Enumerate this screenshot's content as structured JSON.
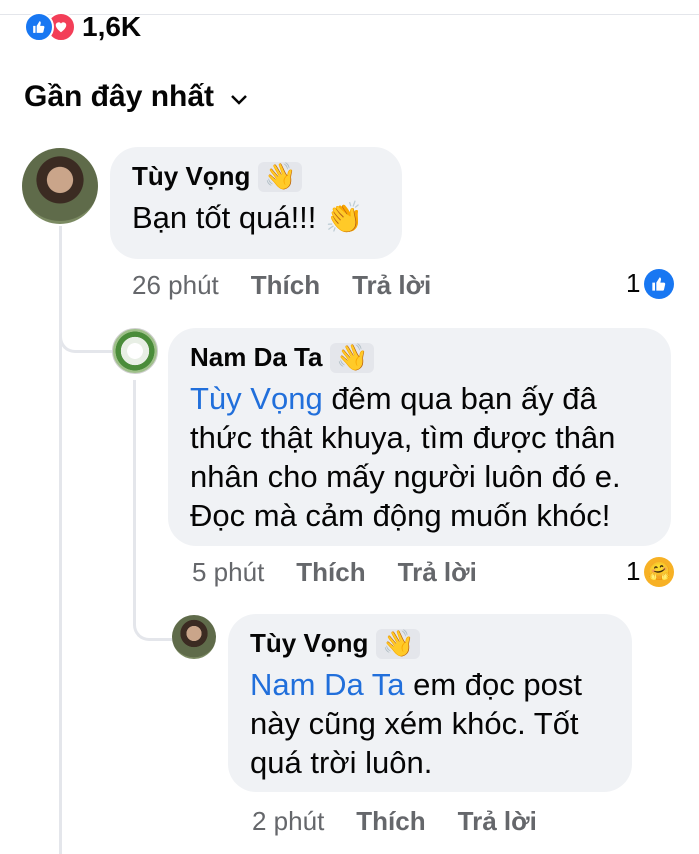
{
  "reactions": {
    "count": "1,6K",
    "icons": [
      "like-icon",
      "love-icon"
    ]
  },
  "sort": {
    "label": "Gần đây nhất"
  },
  "comments": [
    {
      "author": "Tùy Vọng",
      "text": "Bạn tốt quá!!!",
      "emoji": "👏",
      "time": "26 phút",
      "like": "Thích",
      "reply": "Trả lời",
      "reaction_count": "1",
      "reaction_icon": "like-icon"
    },
    {
      "author": "Nam Da Ta",
      "mention": "Tùy Vọng",
      "text": " đêm qua bạn ấy đâ thức thật khuya, tìm được thân nhân cho mấy người luôn đó e. Đọc mà cảm động muốn khóc!",
      "time": "5 phút",
      "like": "Thích",
      "reply": "Trả lời",
      "reaction_count": "1",
      "reaction_icon": "care-icon"
    },
    {
      "author": "Tùy Vọng",
      "mention": "Nam Da Ta",
      "text": " em đọc post này cũng xém khóc. Tốt quá trời luôn.",
      "time": "2 phút",
      "like": "Thích",
      "reply": "Trả lời"
    }
  ],
  "colors": {
    "link": "#216fdb",
    "meta": "#65676b",
    "bubble": "#f0f2f5",
    "like": "#1877f2",
    "love": "#f33e58"
  }
}
